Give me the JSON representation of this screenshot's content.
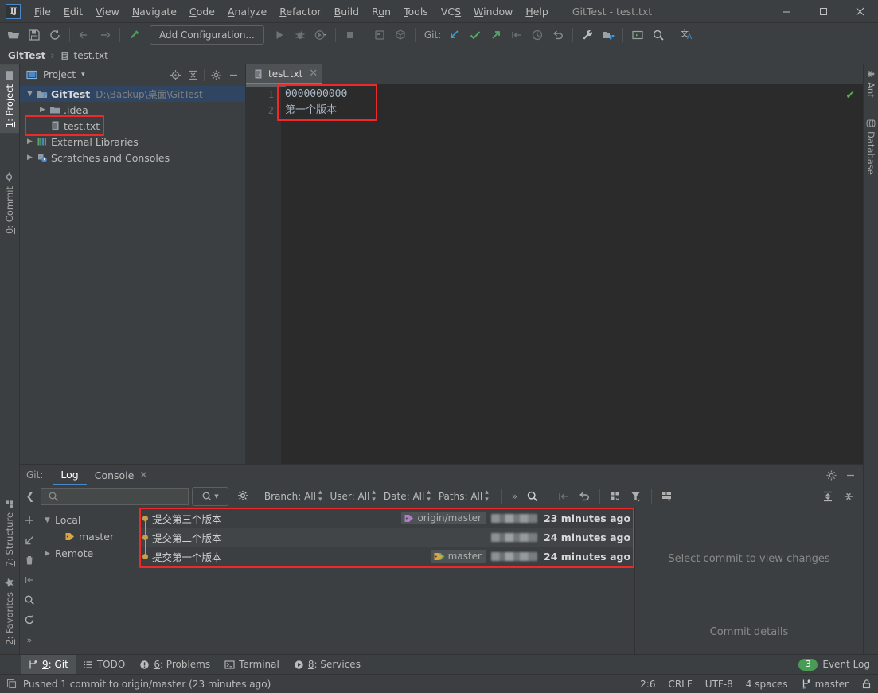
{
  "window": {
    "title": "GitTest - test.txt",
    "minimize": "—",
    "maximize": "▭",
    "close": "✕"
  },
  "menu": {
    "items": [
      {
        "label": "File",
        "mnemonic": "F"
      },
      {
        "label": "Edit",
        "mnemonic": "E"
      },
      {
        "label": "View",
        "mnemonic": "V"
      },
      {
        "label": "Navigate",
        "mnemonic": "N"
      },
      {
        "label": "Code",
        "mnemonic": "C"
      },
      {
        "label": "Analyze",
        "mnemonic": "A"
      },
      {
        "label": "Refactor",
        "mnemonic": "R"
      },
      {
        "label": "Build",
        "mnemonic": "B"
      },
      {
        "label": "Run",
        "mnemonic": "u"
      },
      {
        "label": "Tools",
        "mnemonic": "T"
      },
      {
        "label": "VCS",
        "mnemonic": "S"
      },
      {
        "label": "Window",
        "mnemonic": "W"
      },
      {
        "label": "Help",
        "mnemonic": "H"
      }
    ]
  },
  "toolbar": {
    "add_configuration": "Add Configuration...",
    "git_label": "Git:",
    "icons": [
      "open-folder-icon",
      "save-all-icon",
      "sync-icon",
      "back-arrow-icon",
      "forward-arrow-icon",
      "build-icon",
      "run-icon",
      "debug-icon",
      "run-with-coverage-icon",
      "profiler-icon",
      "stop-icon",
      "app-inspection-icon",
      "device-manager-icon",
      "update-project-icon",
      "commit-icon",
      "push-icon",
      "rebase-icon",
      "history-icon",
      "rollback-icon",
      "settings-wrench-icon",
      "project-structure-icon",
      "terminal-icon",
      "search-everywhere-icon",
      "translate-icon"
    ]
  },
  "breadcrumb": {
    "project": "GitTest",
    "separator": "›",
    "file": "test.txt"
  },
  "left_strip": {
    "top": [
      {
        "label": "1: Project",
        "mnemonic": "1",
        "icon": "project-icon",
        "selected": true
      }
    ],
    "middle": [
      {
        "label": "0: Commit",
        "mnemonic": "0",
        "icon": "commit-icon",
        "selected": false
      }
    ],
    "bottom": [
      {
        "label": "7: Structure",
        "mnemonic": "7",
        "icon": "structure-icon"
      },
      {
        "label": "2: Favorites",
        "mnemonic": "2",
        "icon": "favorites-star-icon"
      }
    ]
  },
  "right_strip": {
    "items": [
      {
        "label": "Ant",
        "icon": "ant-icon"
      },
      {
        "label": "Database",
        "icon": "database-icon"
      }
    ]
  },
  "project_pane": {
    "title": "Project",
    "dropdown_caret": "▾",
    "header_icons": [
      "locate-icon",
      "collapse-all-icon",
      "gear-icon",
      "hide-icon"
    ],
    "tree": [
      {
        "label": "GitTest",
        "path": "D:\\Backup\\桌面\\GitTest",
        "indent": 0,
        "arrow": "expanded",
        "icon": "module-icon",
        "selected": true,
        "bold": true,
        "highlight": false
      },
      {
        "label": ".idea",
        "path": "",
        "indent": 1,
        "arrow": "collapsed",
        "icon": "folder-icon",
        "selected": false,
        "bold": false,
        "highlight": false
      },
      {
        "label": "test.txt",
        "path": "",
        "indent": 2,
        "arrow": "none",
        "icon": "file-txt-icon",
        "selected": false,
        "bold": false,
        "highlight": true
      },
      {
        "label": "External Libraries",
        "path": "",
        "indent": 0,
        "arrow": "collapsed",
        "icon": "libraries-icon",
        "selected": false,
        "bold": false,
        "highlight": false
      },
      {
        "label": "Scratches and Consoles",
        "path": "",
        "indent": 0,
        "arrow": "collapsed",
        "icon": "scratches-icon",
        "selected": false,
        "bold": false,
        "highlight": false
      }
    ]
  },
  "editor": {
    "tab": {
      "label": "test.txt",
      "icon": "file-txt-icon",
      "close": "✕"
    },
    "lines": [
      {
        "number": "1",
        "text": "0000000000"
      },
      {
        "number": "2",
        "text": "第一个版本"
      }
    ],
    "inspection_status": "✔"
  },
  "git_tool": {
    "label": "Git:",
    "tabs": [
      {
        "label": "Log",
        "active": true,
        "closable": false
      },
      {
        "label": "Console",
        "active": false,
        "closable": true,
        "close": "✕"
      }
    ],
    "header_icons": [
      "gear-icon",
      "hide-icon"
    ],
    "toolbar": {
      "back_icon": "chevron-left-icon",
      "search_placeholder": "",
      "search_icon": "search-icon",
      "search_dropdown_icon": "search-dropdown-icon",
      "gear_icon": "gear-dropdown-icon",
      "filters": [
        {
          "label": "Branch: All"
        },
        {
          "label": "User: All"
        },
        {
          "label": "Date: All"
        },
        {
          "label": "Paths: All"
        }
      ],
      "overflow": "»",
      "find_icon": "search-icon",
      "right_icons": [
        "cherry-pick-icon",
        "revert-icon",
        "show-diff-icon",
        "filter-icon",
        "layout-icon",
        "expand-all-icon",
        "collapse-all-icon"
      ]
    },
    "left_tools": [
      "add-icon",
      "checkout-icon",
      "delete-icon",
      "merge-icon",
      "search-icon",
      "refresh-icon",
      "more-icon"
    ],
    "branches": [
      {
        "label": "Local",
        "indent": 0,
        "arrow": "expanded",
        "icon": ""
      },
      {
        "label": "master",
        "indent": 1,
        "arrow": "none",
        "icon": "branch-tag-icon"
      },
      {
        "label": "Remote",
        "indent": 0,
        "arrow": "collapsed",
        "icon": ""
      }
    ],
    "commits": [
      {
        "subject": "提交第三个版本",
        "refs": [
          {
            "name": "origin/master",
            "type": "remote"
          }
        ],
        "author": "",
        "date": "23 minutes ago"
      },
      {
        "subject": "提交第二个版本",
        "refs": [],
        "author": "",
        "date": "24 minutes ago"
      },
      {
        "subject": "提交第一个版本",
        "refs": [
          {
            "name": "master",
            "type": "local"
          }
        ],
        "author": "",
        "date": "24 minutes ago"
      }
    ],
    "changes_empty_text": "Select commit to view changes",
    "commit_details_text": "Commit details"
  },
  "bottom_bar": {
    "items": [
      {
        "label": "9: Git",
        "mnemonic": "9",
        "icon": "git-branch-icon",
        "active": true
      },
      {
        "label": "TODO",
        "mnemonic": "",
        "icon": "todo-icon",
        "active": false
      },
      {
        "label": "6: Problems",
        "mnemonic": "6",
        "icon": "problems-icon",
        "active": false
      },
      {
        "label": "Terminal",
        "mnemonic": "",
        "icon": "terminal-icon",
        "active": false
      },
      {
        "label": "8: Services",
        "mnemonic": "8",
        "icon": "services-icon",
        "active": false
      }
    ],
    "event_log": {
      "label": "Event Log",
      "count": "3"
    }
  },
  "status_bar": {
    "message": "Pushed 1 commit to origin/master (23 minutes ago)",
    "message_icon": "copy-icon",
    "caret_position": "2:6",
    "line_separator": "CRLF",
    "encoding": "UTF-8",
    "indent": "4 spaces",
    "branch": "master",
    "branch_icon": "git-branch-icon",
    "lock_icon": "lock-icon"
  },
  "colors": {
    "accent": "#4a88c7",
    "highlight_box": "#ef2929",
    "background": "#3c3f41",
    "editor_background": "#2b2b2b",
    "selection": "#2f4561",
    "badge_green": "#499c54",
    "tag_yellow": "#d9a441",
    "tag_purple": "#b07cc6"
  }
}
